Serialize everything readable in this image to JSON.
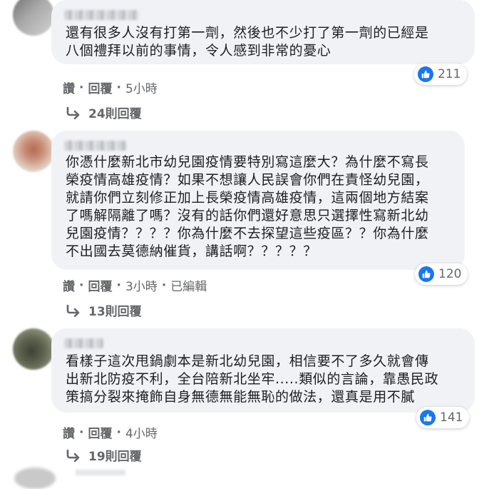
{
  "comments": [
    {
      "text": "還有很多人沒有打第一劑，然後也不少打了第一劑的已經是\n八個禮拜以前的事情，令人感到非常的憂心",
      "reaction_count": "211",
      "actions": {
        "like": "讚",
        "reply": "回覆",
        "time": "5小時",
        "edited": ""
      },
      "replies_label": "24則回覆",
      "avatar_colors": [
        "#8a8a8a",
        "#c8c8c8"
      ]
    },
    {
      "text": "你憑什麼新北市幼兒園疫情要特別寫這麼大？為什麼不寫長\n榮疫情高雄疫情？如果不想讓人民誤會你們在責怪幼兒園，\n就請你們立刻修正加上長榮疫情高雄疫情，這兩個地方結案\n了嗎解隔離了嗎？沒有的話你們還好意思只選擇性寫新北幼\n兒園疫情？？？？你為什麼不去探望這些疫區？？你為什麼\n不出國去莫德納催貨，講話啊？？？？？",
      "reaction_count": "120",
      "actions": {
        "like": "讚",
        "reply": "回覆",
        "time": "3小時",
        "edited": "已編輯"
      },
      "replies_label": "13則回覆",
      "avatar_colors": [
        "#a1624e",
        "#d9c2b3"
      ]
    },
    {
      "text": "看樣子這次甩鍋劇本是新北幼兒園，相信要不了多久就會傳\n出新北防疫不利，全台陪新北坐牢.....類似的言論，靠愚民政\n策搞分裂來掩飾自身無德無能無恥的做法，還真是用不膩",
      "reaction_count": "141",
      "actions": {
        "like": "讚",
        "reply": "回覆",
        "time": "4小時",
        "edited": ""
      },
      "replies_label": "19則回覆",
      "avatar_colors": [
        "#4a4f3f",
        "#9aa08a"
      ]
    }
  ],
  "colors": {
    "bubble": "#f0f2f5",
    "like_blue": "#1877f2",
    "secondary_text": "#65676b"
  }
}
